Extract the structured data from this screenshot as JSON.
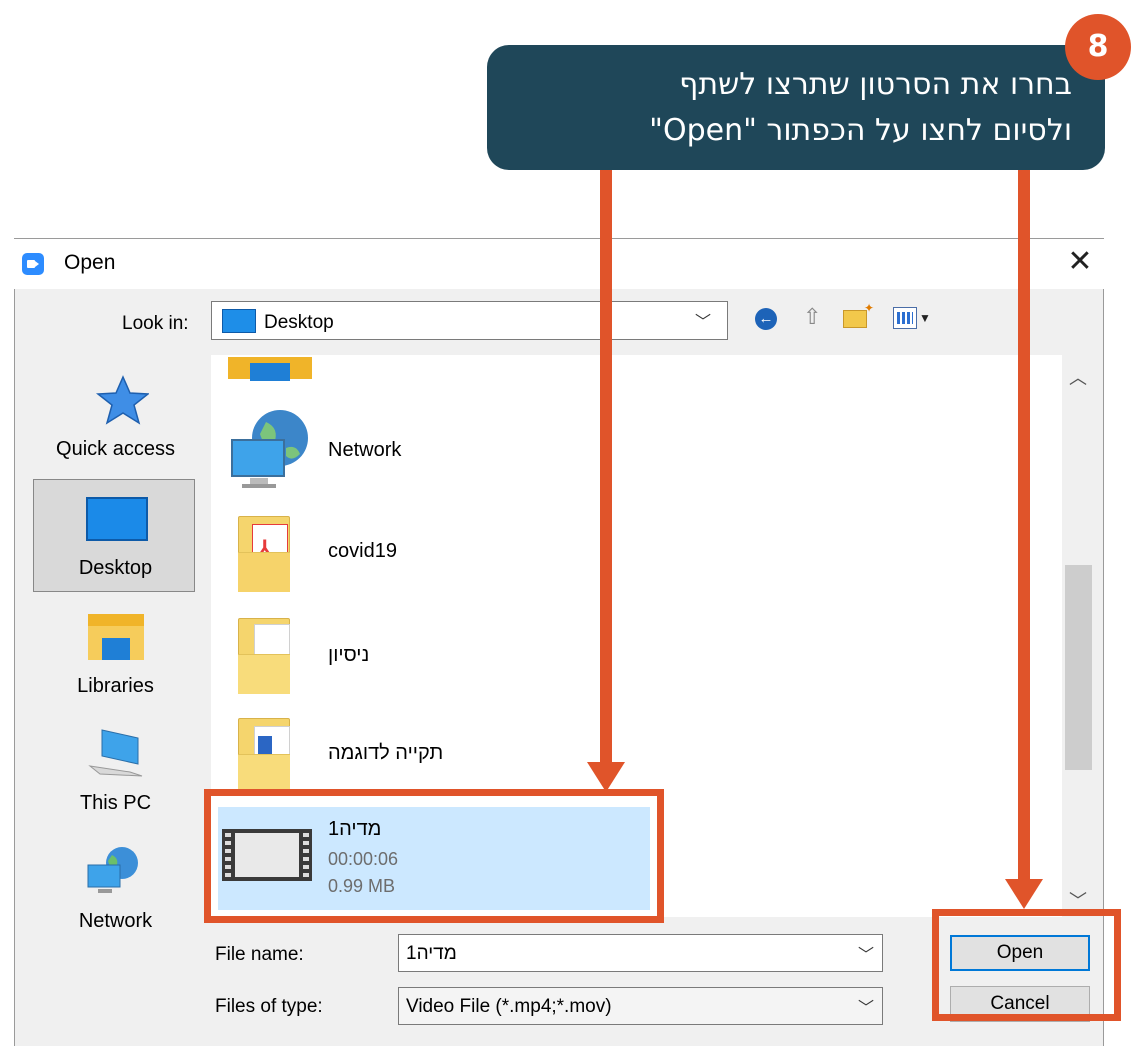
{
  "callout": {
    "step": "8",
    "line1": "בחרו את הסרטון שתרצו לשתף",
    "line2": "ולסיום לחצו על הכפתור \"Open\""
  },
  "dialog": {
    "title": "Open",
    "close_glyph": "✕",
    "look_in_label": "Look in:",
    "look_in_value": "Desktop",
    "toolbar_icons": [
      "back-icon",
      "up-folder-icon",
      "new-folder-icon",
      "view-menu-icon"
    ]
  },
  "places": [
    {
      "label": "Quick access",
      "icon": "star-icon"
    },
    {
      "label": "Desktop",
      "icon": "desktop-icon",
      "selected": true
    },
    {
      "label": "Libraries",
      "icon": "libraries-icon"
    },
    {
      "label": "This PC",
      "icon": "computer-icon"
    },
    {
      "label": "Network",
      "icon": "network-icon"
    }
  ],
  "files": [
    {
      "name": "Network",
      "icon": "network-globe-icon"
    },
    {
      "name": "covid19",
      "icon": "pdf-folder-icon"
    },
    {
      "name": "ניסיון",
      "icon": "folder-icon"
    },
    {
      "name": "תקייה לדוגמה",
      "icon": "doc-folder-icon"
    },
    {
      "name": "מדיה1",
      "duration": "00:00:06",
      "size": "0.99 MB",
      "icon": "video-icon",
      "selected": true
    }
  ],
  "fields": {
    "file_name_label": "File name:",
    "file_name_value": "מדיה1",
    "file_type_label": "Files of type:",
    "file_type_value": "Video File (*.mp4;*.mov)"
  },
  "buttons": {
    "open": "Open",
    "cancel": "Cancel"
  },
  "colors": {
    "callout_bg": "#1f4759",
    "annotation": "#e0542a",
    "selection": "#cce8ff",
    "primary_border": "#0078d7"
  }
}
